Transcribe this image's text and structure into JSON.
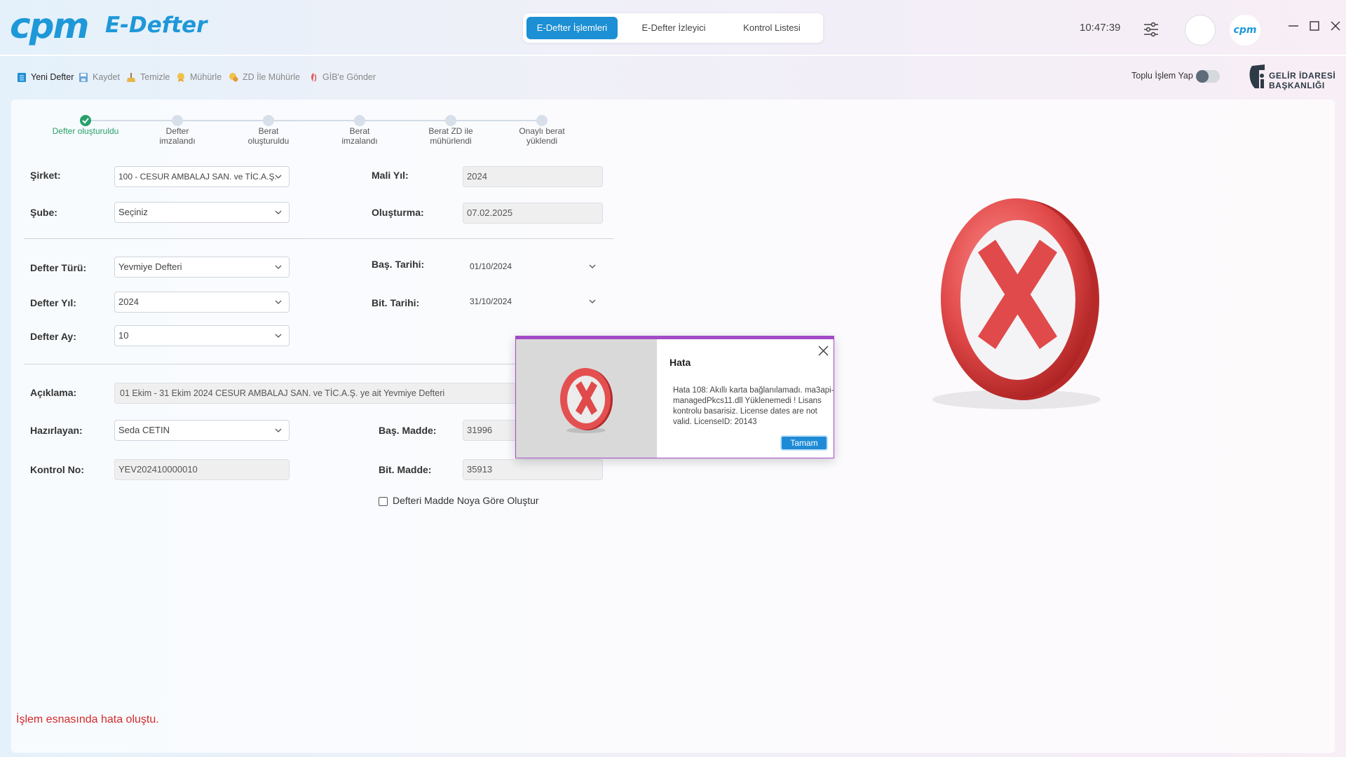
{
  "app": {
    "logo": "cpm",
    "title": "E-Defter",
    "clock": "10:47:39",
    "avatar_text": "cpm"
  },
  "tabs": [
    {
      "label": "E-Defter İşlemleri",
      "active": true
    },
    {
      "label": "E-Defter İzleyici",
      "active": false
    },
    {
      "label": "Kontrol Listesi",
      "active": false
    }
  ],
  "toolbar": {
    "items": [
      {
        "label": "Yeni Defter",
        "icon": "notebook-icon"
      },
      {
        "label": "Kaydet",
        "icon": "save-icon"
      },
      {
        "label": "Temizle",
        "icon": "broom-icon"
      },
      {
        "label": "Mühürle",
        "icon": "seal-icon"
      },
      {
        "label": "ZD İle Mühürle",
        "icon": "seal-timestamp-icon"
      },
      {
        "label": "GİB'e Gönder",
        "icon": "send-icon"
      }
    ],
    "bulk_label": "Toplu İşlem Yap",
    "bulk_enabled": false,
    "gib_logo_text": [
      "GELİR İDARESİ",
      "BAŞKANLIĞI"
    ]
  },
  "steps": [
    {
      "lines": [
        "Defter oluşturuldu"
      ],
      "done": true
    },
    {
      "lines": [
        "Defter",
        "imzalandı"
      ],
      "done": false
    },
    {
      "lines": [
        "Berat",
        "oluşturuldu"
      ],
      "done": false
    },
    {
      "lines": [
        "Berat",
        "imzalandı"
      ],
      "done": false
    },
    {
      "lines": [
        "Berat ZD ile",
        "mühürlendi"
      ],
      "done": false
    },
    {
      "lines": [
        "Onaylı berat",
        "yüklendi"
      ],
      "done": false
    }
  ],
  "form": {
    "sirket": {
      "label": "Şirket:",
      "value": "100 - CESUR AMBALAJ SAN. ve TİC.A.Ş."
    },
    "sube": {
      "label": "Şube:",
      "value": "Seçiniz"
    },
    "mali_yil": {
      "label": "Mali Yıl:",
      "value": "2024"
    },
    "olusturma": {
      "label": "Oluşturma:",
      "value": "07.02.2025"
    },
    "defter_turu": {
      "label": "Defter Türü:",
      "value": "Yevmiye Defteri"
    },
    "defter_yil": {
      "label": "Defter Yıl:",
      "value": "2024"
    },
    "defter_ay": {
      "label": "Defter Ay:",
      "value": "10"
    },
    "bas_tarihi": {
      "label": "Baş. Tarihi:",
      "value": "01/10/2024"
    },
    "bit_tarihi": {
      "label": "Bit. Tarihi:",
      "value": "31/10/2024"
    },
    "aciklama": {
      "label": "Açıklama:",
      "value": "01 Ekim - 31 Ekim 2024 CESUR AMBALAJ SAN. ve TİC.A.Ş. ye ait Yevmiye Defteri"
    },
    "hazirlayan": {
      "label": "Hazırlayan:",
      "value": "Seda CETIN"
    },
    "kontrol_no": {
      "label": "Kontrol No:",
      "value": "YEV202410000010"
    },
    "bas_madde": {
      "label": "Baş. Madde:",
      "value": "31996"
    },
    "bit_madde": {
      "label": "Bit. Madde:",
      "value": "35913"
    },
    "madde_checkbox": {
      "label": "Defteri Madde Noya Göre Oluştur",
      "checked": false
    }
  },
  "status": {
    "error_text": "İşlem esnasında hata oluştu.",
    "color": "#d22a2a"
  },
  "dialog": {
    "title": "Hata",
    "message": "Hata 108: Akıllı karta bağlanılamadı. ma3api-managedPkcs11.dll Yüklenemedi ! Lisans kontrolu basarisiz. License dates are not valid. LicenseID: 20143",
    "ok_label": "Tamam",
    "border_color": "#a24bc6"
  },
  "colors": {
    "accent": "#1d8fd4",
    "success": "#27a06a",
    "error": "#d22a2a"
  }
}
